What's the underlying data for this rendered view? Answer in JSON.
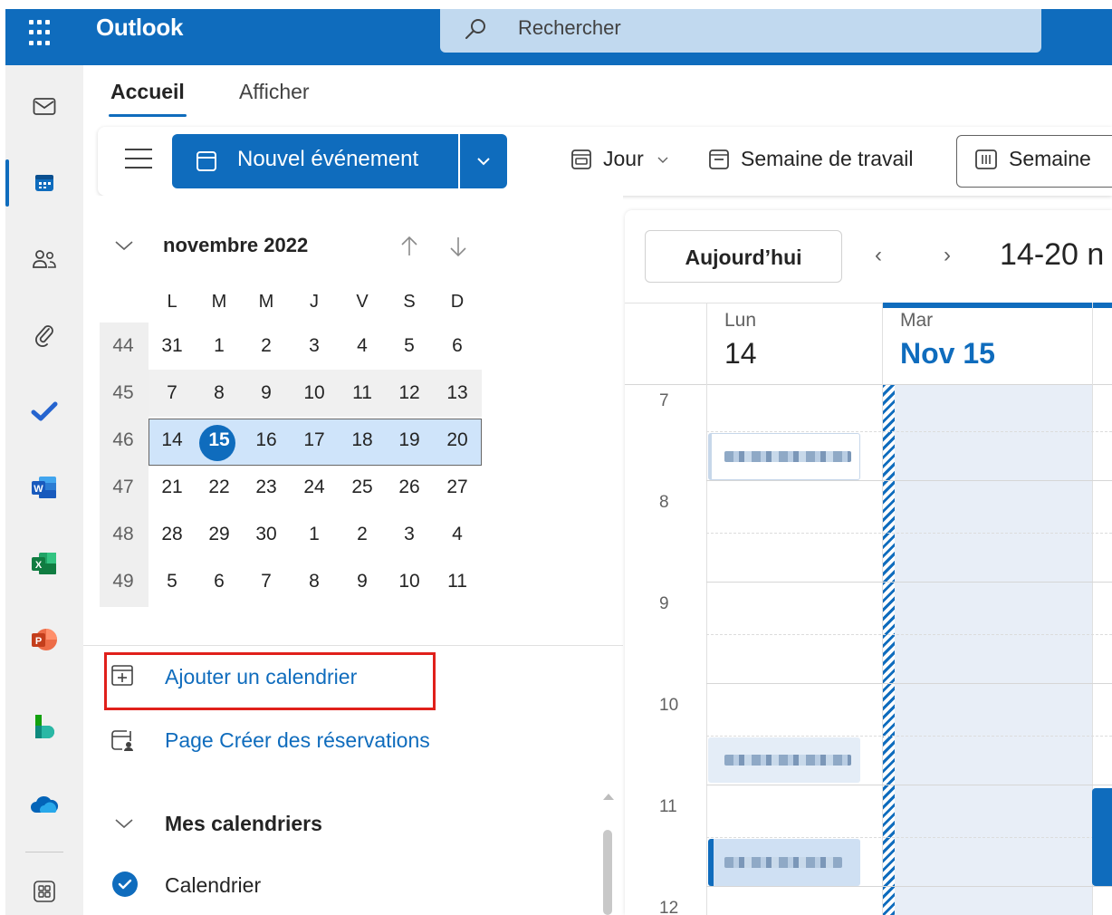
{
  "app": {
    "name": "Outlook"
  },
  "search": {
    "placeholder": "Rechercher"
  },
  "tabs": [
    {
      "label": "Accueil",
      "active": true
    },
    {
      "label": "Afficher",
      "active": false
    }
  ],
  "ribbon": {
    "new_event_label": "Nouvel événement",
    "views": [
      {
        "label": "Jour",
        "has_dropdown": true,
        "icon": "day-view-icon"
      },
      {
        "label": "Semaine de travail",
        "icon": "work-week-icon"
      },
      {
        "label": "Semaine",
        "icon": "week-view-icon",
        "selected": true
      }
    ]
  },
  "rail": [
    {
      "name": "mail-icon"
    },
    {
      "name": "calendar-icon",
      "active": true
    },
    {
      "name": "people-icon"
    },
    {
      "name": "attachment-icon"
    },
    {
      "name": "todo-icon"
    },
    {
      "name": "word-icon",
      "letter": "W"
    },
    {
      "name": "excel-icon",
      "letter": "X"
    },
    {
      "name": "powerpoint-icon",
      "letter": "P"
    },
    {
      "name": "bookings-icon"
    },
    {
      "name": "onedrive-icon"
    },
    {
      "name": "more-apps-icon"
    }
  ],
  "mini_calendar": {
    "title": "novembre 2022",
    "day_headers": [
      "L",
      "M",
      "M",
      "J",
      "V",
      "S",
      "D"
    ],
    "weeks": [
      {
        "num": "44",
        "days": [
          "31",
          "1",
          "2",
          "3",
          "4",
          "5",
          "6"
        ]
      },
      {
        "num": "45",
        "days": [
          "7",
          "8",
          "9",
          "10",
          "11",
          "12",
          "13"
        ]
      },
      {
        "num": "46",
        "days": [
          "14",
          "15",
          "16",
          "17",
          "18",
          "19",
          "20"
        ]
      },
      {
        "num": "47",
        "days": [
          "21",
          "22",
          "23",
          "24",
          "25",
          "26",
          "27"
        ]
      },
      {
        "num": "48",
        "days": [
          "28",
          "29",
          "30",
          "1",
          "2",
          "3",
          "4"
        ]
      },
      {
        "num": "49",
        "days": [
          "5",
          "6",
          "7",
          "8",
          "9",
          "10",
          "11"
        ]
      }
    ],
    "today": "15"
  },
  "links": {
    "add_calendar": "Ajouter un calendrier",
    "booking_page": "Page Créer des réservations"
  },
  "my_calendars": {
    "title": "Mes calendriers",
    "items": [
      {
        "name": "Calendrier",
        "checked": true
      }
    ]
  },
  "main": {
    "today_button": "Aujourd’hui",
    "range": "14-20 n",
    "days": [
      {
        "label": "Lun",
        "num": "14"
      },
      {
        "label": "Mar",
        "num": "Nov 15",
        "today": true
      }
    ],
    "hours": [
      "7",
      "8",
      "9",
      "10",
      "11",
      "12"
    ]
  },
  "colors": {
    "brand": "#0f6cbd",
    "highlight": "#e0201b",
    "selected_week": "#cfe4fa"
  }
}
